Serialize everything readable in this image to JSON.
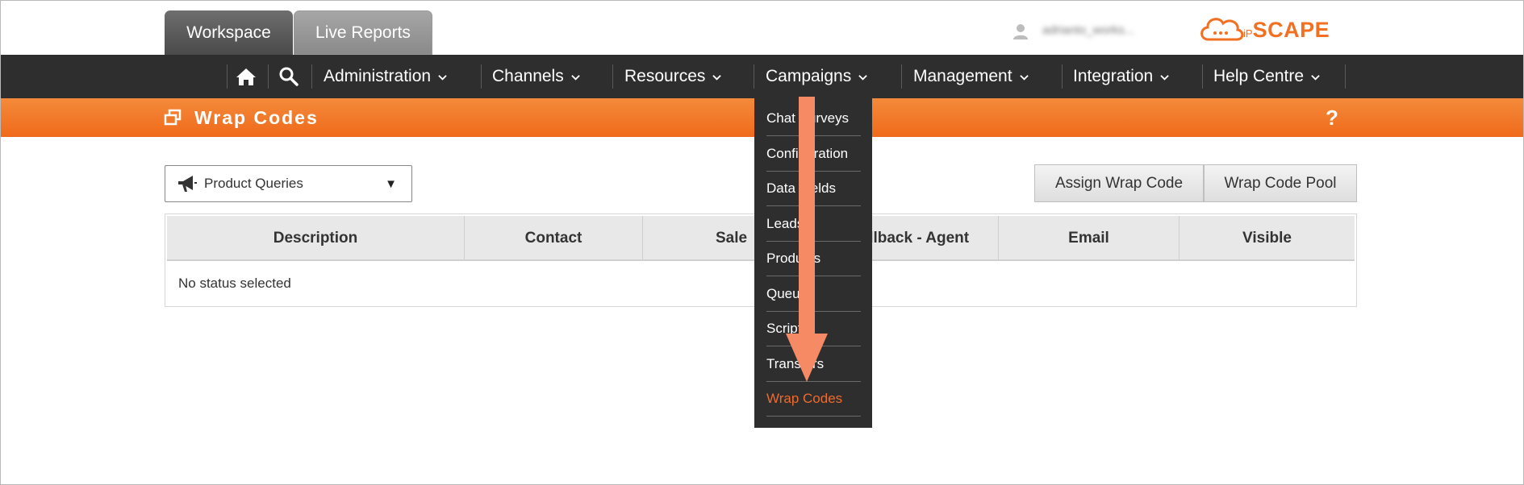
{
  "tabs": {
    "workspace": "Workspace",
    "live_reports": "Live Reports"
  },
  "user": {
    "name": "adrianto_works..."
  },
  "brand": {
    "logo_prefix": "iP",
    "logo_main": "SCAPE",
    "color": "#f36f21"
  },
  "nav": {
    "home_icon": "home-icon",
    "search_icon": "search-icon",
    "items": [
      {
        "label": "Administration"
      },
      {
        "label": "Channels"
      },
      {
        "label": "Resources"
      },
      {
        "label": "Campaigns"
      },
      {
        "label": "Management"
      },
      {
        "label": "Integration"
      },
      {
        "label": "Help Centre"
      }
    ]
  },
  "page": {
    "title": "Wrap Codes",
    "help": "?"
  },
  "campaign_select": {
    "value": "Product Queries",
    "caret": "▼"
  },
  "buttons": {
    "assign": "Assign Wrap Code",
    "pool": "Wrap Code Pool"
  },
  "table": {
    "headers": [
      "Description",
      "Contact",
      "Sale",
      "Callback - Agent",
      "Email",
      "Visible"
    ],
    "empty_message": "No status selected"
  },
  "campaigns_menu": {
    "items": [
      "Chat Surveys",
      "Configuration",
      "Data Fields",
      "Leads",
      "Products",
      "Queues",
      "Scripts",
      "Transfers",
      "Wrap Codes"
    ],
    "active": "Wrap Codes",
    "active_color": "#ef6a2d"
  },
  "annotation": {
    "arrow_color": "#f58a64"
  }
}
